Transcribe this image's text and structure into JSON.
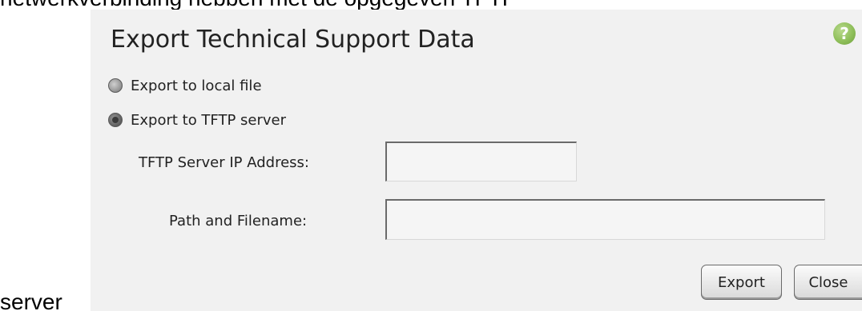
{
  "background_text": {
    "top": "netwerkverbinding hebben met de opgegeven TFTP",
    "bottom": "server"
  },
  "dialog": {
    "title": "Export Technical Support Data",
    "help_icon": {
      "icon": "question-mark-icon",
      "glyph": "?",
      "color": "#8fbf5a"
    },
    "options": [
      {
        "label": "Export to local file",
        "checked": false
      },
      {
        "label": "Export to TFTP server",
        "checked": true
      }
    ],
    "tftp_ip": {
      "label": "TFTP Server IP Address:",
      "value": ""
    },
    "path_filename": {
      "label": "Path and Filename:",
      "value": ""
    },
    "buttons": {
      "export": "Export",
      "close": "Close"
    }
  }
}
